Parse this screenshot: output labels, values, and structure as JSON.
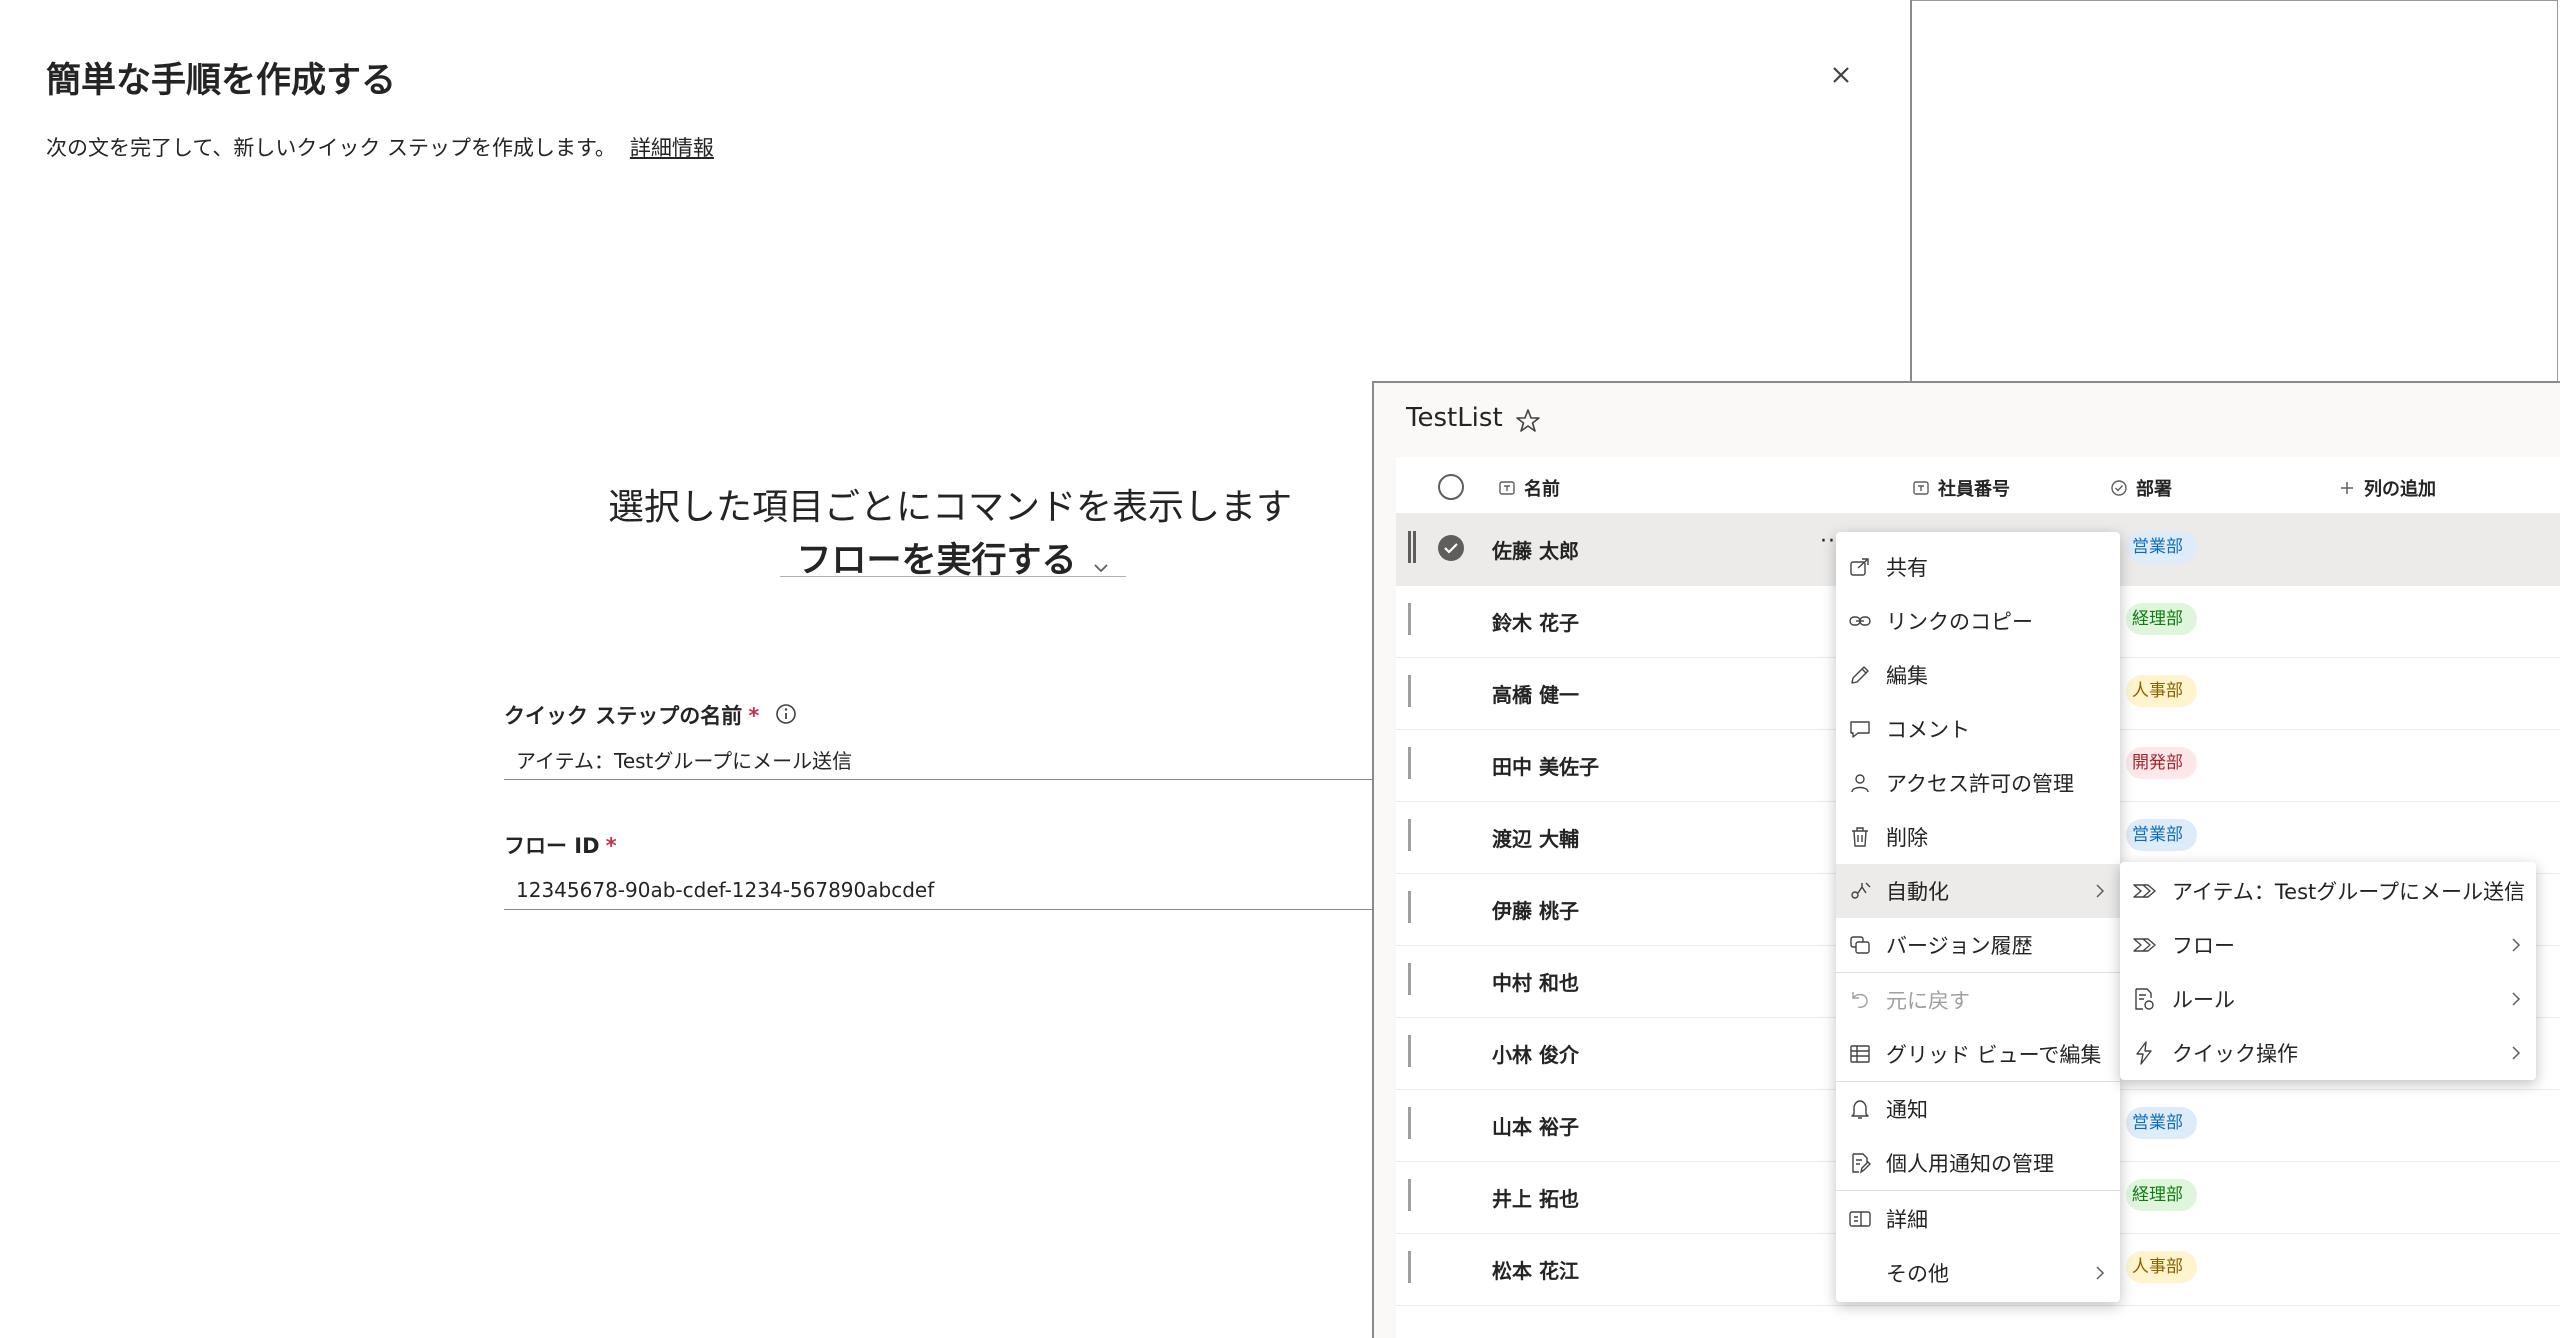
{
  "dialog": {
    "title": "簡単な手順を作成する",
    "subtitle": "次の文を完了して、新しいクイック ステップを作成します。",
    "learn_more": "詳細情報",
    "sentence": "選択した項目ごとにコマンドを表示します",
    "action_value": "フローを実行する",
    "fields": {
      "name_label": "クイック ステップの名前",
      "name_required": "*",
      "name_value": "アイテム：Testグループにメール送信",
      "flow_label": "フロー ID",
      "flow_required": "*",
      "flow_value": "12345678-90ab-cdef-1234-567890abcdef"
    }
  },
  "list": {
    "title": "TestList",
    "columns": {
      "name": "名前",
      "employee_no": "社員番号",
      "department": "部署",
      "add_column": "列の追加"
    },
    "rows": [
      {
        "name": "佐藤 太郎",
        "dept": "営業部"
      },
      {
        "name": "鈴木 花子",
        "dept": "経理部"
      },
      {
        "name": "高橋 健一",
        "dept": "人事部"
      },
      {
        "name": "田中 美佐子",
        "dept": "開発部"
      },
      {
        "name": "渡辺 大輔",
        "dept": "営業部"
      },
      {
        "name": "伊藤 桃子",
        "dept": ""
      },
      {
        "name": "中村 和也",
        "dept": ""
      },
      {
        "name": "小林 俊介",
        "dept": ""
      },
      {
        "name": "山本 裕子",
        "dept": "営業部"
      },
      {
        "name": "井上 拓也",
        "dept": "経理部"
      },
      {
        "name": "松本 花江",
        "dept": "人事部"
      }
    ],
    "more_glyph": "···"
  },
  "menu": {
    "items": [
      {
        "label": "共有",
        "icon": "share-icon"
      },
      {
        "label": "リンクのコピー",
        "icon": "link-icon"
      },
      {
        "label": "編集",
        "icon": "pencil-icon"
      },
      {
        "label": "コメント",
        "icon": "comment-icon"
      },
      {
        "label": "アクセス許可の管理",
        "icon": "person-icon"
      },
      {
        "label": "削除",
        "icon": "trash-icon"
      },
      {
        "label": "自動化",
        "icon": "automate-icon"
      },
      {
        "label": "バージョン履歴",
        "icon": "history-icon"
      },
      {
        "label": "元に戻す",
        "icon": "undo-icon"
      },
      {
        "label": "グリッド ビューで編集",
        "icon": "grid-icon"
      },
      {
        "label": "通知",
        "icon": "bell-icon"
      },
      {
        "label": "個人用通知の管理",
        "icon": "alert-manage-icon"
      },
      {
        "label": "詳細",
        "icon": "details-icon"
      },
      {
        "label": "その他",
        "icon": ""
      }
    ],
    "submenu": [
      {
        "label": "アイテム：Testグループにメール送信",
        "icon": "flow-icon"
      },
      {
        "label": "フロー",
        "icon": "flow-icon"
      },
      {
        "label": "ルール",
        "icon": "rule-icon"
      },
      {
        "label": "クイック操作",
        "icon": "quick-action-icon"
      }
    ]
  },
  "colors": {
    "sales_bg": "#deecf9",
    "sales_fg": "#0f6cbd",
    "accounting_bg": "#dff6dd",
    "accounting_fg": "#107c10",
    "hr_bg": "#fff4ce",
    "hr_fg": "#8a6100",
    "dev_bg": "#fde7e9",
    "dev_fg": "#a4262c",
    "required": "#c4314b"
  }
}
